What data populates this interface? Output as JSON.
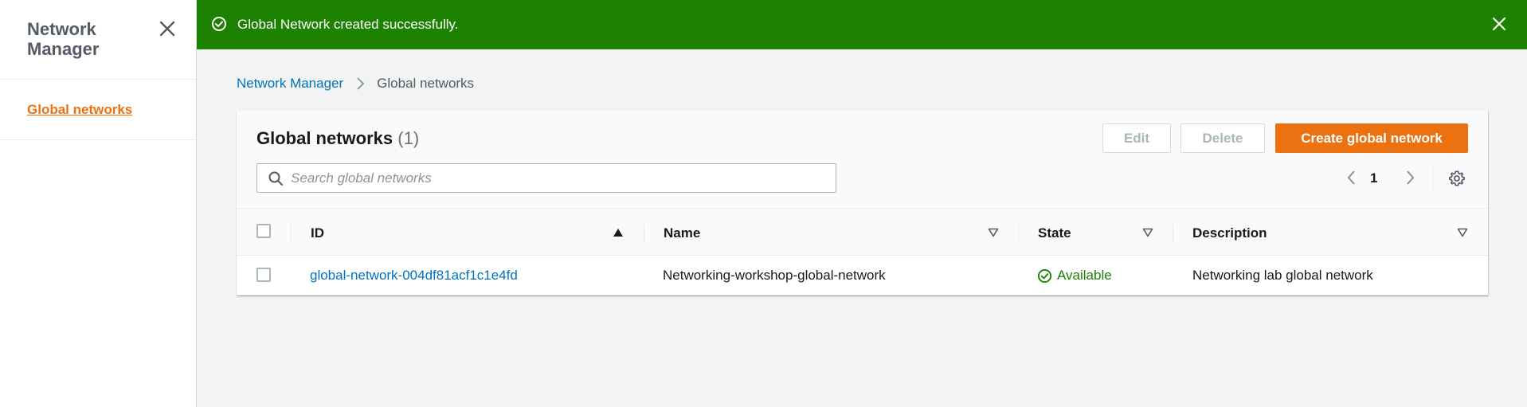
{
  "sidebar": {
    "title": "Network Manager",
    "items": [
      {
        "label": "Global networks",
        "active": true
      }
    ]
  },
  "flash": {
    "message": "Global Network created successfully.",
    "color": "#1d8102"
  },
  "breadcrumb": {
    "items": [
      "Network Manager",
      "Global networks"
    ]
  },
  "panel": {
    "title": "Global networks",
    "count": "(1)",
    "buttons": {
      "edit": "Edit",
      "delete": "Delete",
      "create": "Create global network"
    },
    "search_placeholder": "Search global networks",
    "pagination": {
      "current_page": "1"
    }
  },
  "table": {
    "columns": [
      "ID",
      "Name",
      "State",
      "Description"
    ],
    "sorted_column": "ID",
    "sort_direction": "ascending",
    "rows": [
      {
        "id": "global-network-004df81acf1c1e4fd",
        "name": "Networking-workshop-global-network",
        "state": "Available",
        "description": "Networking lab global network"
      }
    ]
  },
  "colors": {
    "accent": "#ec7211",
    "link": "#0073bb",
    "success": "#1d8102"
  }
}
